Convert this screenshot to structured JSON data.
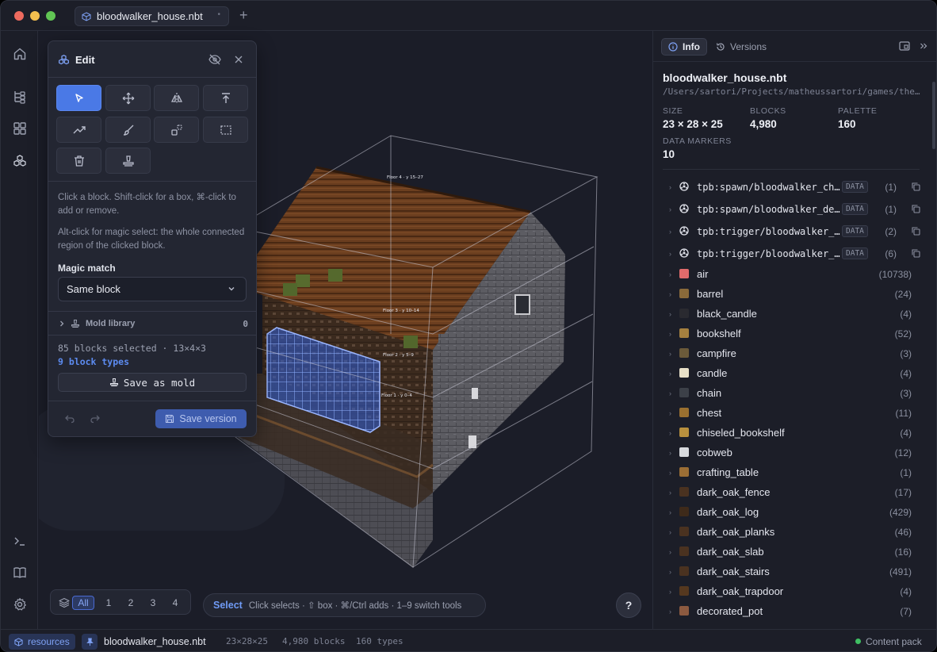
{
  "window": {
    "tab_title": "bloodwalker_house.nbt"
  },
  "edit_panel": {
    "title": "Edit",
    "hint_select": "Click a block. Shift-click for a box, ⌘-click to add or remove.",
    "hint_magic": "Alt-click for magic select: the whole connected region of the clicked block.",
    "magic_match_label": "Magic match",
    "magic_match_value": "Same block",
    "mold_library_label": "Mold library",
    "mold_library_count": "0",
    "selection_info": "85 blocks selected · 13×4×3",
    "selection_types": "9 block types",
    "save_mold_label": "Save as mold",
    "save_version_label": "Save version"
  },
  "scene": {
    "floor_labels": [
      "Floor 4 · y 15–27",
      "Floor 3 · y 10–14",
      "Floor 2 · y 5–9",
      "Floor 1 · y 0–4"
    ]
  },
  "layers": {
    "items": [
      "All",
      "1",
      "2",
      "3",
      "4"
    ]
  },
  "modebar": {
    "mode": "Select",
    "help": "Click selects · ⇧ box · ⌘/Ctrl adds · 1–9 switch tools"
  },
  "help_button": "?",
  "right_panel": {
    "tab_info": "Info",
    "tab_versions": "Versions",
    "file_name": "bloodwalker_house.nbt",
    "file_path": "/Users/sartori/Projects/matheussartori/games/theplague/bloodwalker_house.nbt",
    "stats": [
      {
        "label": "SIZE",
        "value": "23 × 28 × 25"
      },
      {
        "label": "BLOCKS",
        "value": "4,980"
      },
      {
        "label": "PALETTE",
        "value": "160"
      },
      {
        "label": "DATA MARKERS",
        "value": "10"
      }
    ],
    "data_markers": [
      {
        "name": "tpb:spawn/bloodwalker_ch…",
        "tag": "DATA",
        "count": "(1)"
      },
      {
        "name": "tpb:spawn/bloodwalker_de…",
        "tag": "DATA",
        "count": "(1)"
      },
      {
        "name": "tpb:trigger/bloodwalker_…",
        "tag": "DATA",
        "count": "(2)"
      },
      {
        "name": "tpb:trigger/bloodwalker_…",
        "tag": "DATA",
        "count": "(6)"
      }
    ],
    "blocks": [
      {
        "name": "air",
        "count": "(10738)",
        "color": "#e06b6b"
      },
      {
        "name": "barrel",
        "count": "(24)",
        "color": "#8a6a3a"
      },
      {
        "name": "black_candle",
        "count": "(4)",
        "color": "#2a2a30"
      },
      {
        "name": "bookshelf",
        "count": "(52)",
        "color": "#a5803f"
      },
      {
        "name": "campfire",
        "count": "(3)",
        "color": "#6b5a3a"
      },
      {
        "name": "candle",
        "count": "(4)",
        "color": "#e8e0c8"
      },
      {
        "name": "chain",
        "count": "(3)",
        "color": "#3c4048"
      },
      {
        "name": "chest",
        "count": "(11)",
        "color": "#9a7030"
      },
      {
        "name": "chiseled_bookshelf",
        "count": "(4)",
        "color": "#b8903e"
      },
      {
        "name": "cobweb",
        "count": "(12)",
        "color": "#d8dade"
      },
      {
        "name": "crafting_table",
        "count": "(1)",
        "color": "#9b6e35"
      },
      {
        "name": "dark_oak_fence",
        "count": "(17)",
        "color": "#4a3220"
      },
      {
        "name": "dark_oak_log",
        "count": "(429)",
        "color": "#3e2a1a"
      },
      {
        "name": "dark_oak_planks",
        "count": "(46)",
        "color": "#4a3220"
      },
      {
        "name": "dark_oak_slab",
        "count": "(16)",
        "color": "#4a3220"
      },
      {
        "name": "dark_oak_stairs",
        "count": "(491)",
        "color": "#4a3220"
      },
      {
        "name": "dark_oak_trapdoor",
        "count": "(4)",
        "color": "#55381f"
      },
      {
        "name": "decorated_pot",
        "count": "(7)",
        "color": "#8c5a40"
      }
    ]
  },
  "statusbar": {
    "pack": "resources",
    "file": "bloodwalker_house.nbt",
    "size": "23×28×25",
    "blocks": "4,980 blocks",
    "types": "160 types",
    "content_pack": "Content pack"
  }
}
